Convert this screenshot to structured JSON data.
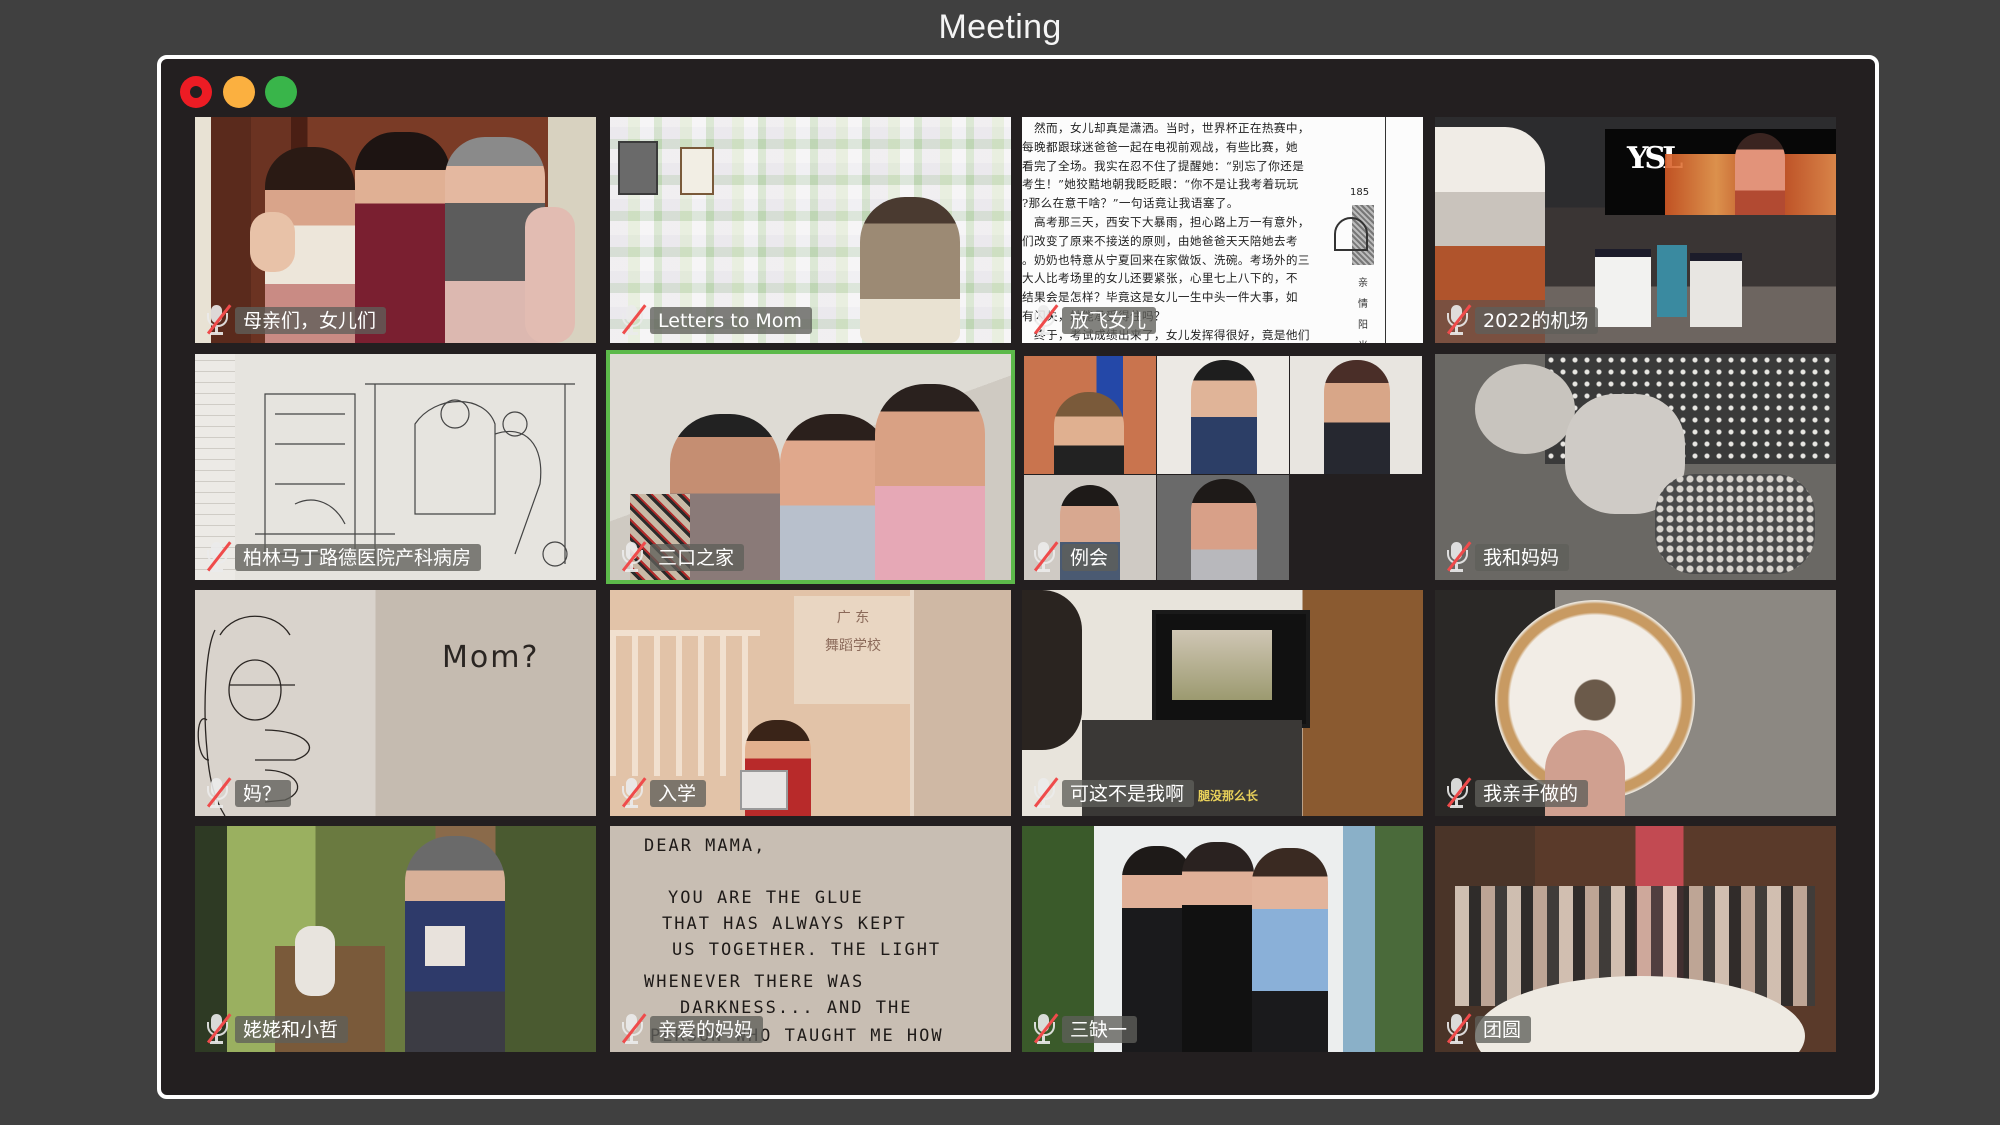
{
  "app": {
    "title": "Meeting"
  },
  "window_controls": {
    "close": "close-button",
    "minimize": "minimize-button",
    "maximize": "maximize-button"
  },
  "colors": {
    "background": "#404040",
    "window": "#231f20",
    "window_border": "#ffffff",
    "close": "#ed1c24",
    "minimize": "#fbb040",
    "maximize": "#39b54a",
    "active_speaker": "#5cb94a",
    "muted_slash": "#ef4b4b"
  },
  "participants": [
    {
      "name": "母亲们，女儿们",
      "muted": true,
      "active": false
    },
    {
      "name": "Letters to Mom",
      "muted": true,
      "active": false
    },
    {
      "name": "放飞女儿",
      "muted": true,
      "active": false
    },
    {
      "name": "2022的机场",
      "muted": true,
      "active": false
    },
    {
      "name": "柏林马丁路德医院产科病房",
      "muted": true,
      "active": false
    },
    {
      "name": "三口之家",
      "muted": true,
      "active": true
    },
    {
      "name": "例会",
      "muted": true,
      "active": false
    },
    {
      "name": "我和妈妈",
      "muted": true,
      "active": false
    },
    {
      "name": "妈？",
      "muted": true,
      "active": false
    },
    {
      "name": "入学",
      "muted": true,
      "active": false
    },
    {
      "name": "可这不是我啊",
      "muted": true,
      "active": false
    },
    {
      "name": "我亲手做的",
      "muted": true,
      "active": false
    },
    {
      "name": "姥姥和小哲",
      "muted": true,
      "active": false
    },
    {
      "name": "亲爱的妈妈",
      "muted": true,
      "active": false
    },
    {
      "name": "三缺一",
      "muted": true,
      "active": false
    },
    {
      "name": "团圆",
      "muted": true,
      "active": false
    }
  ],
  "tile_content": {
    "book_page": {
      "lines": [
        "　然而，女儿却真是潇洒。当时，世界杯正在热赛中，",
        "每晚都跟球迷爸爸一起在电视前观战，有些比赛，她",
        "看完了全场。我实在忍不住了提醒她：“别忘了你还是",
        "考生！”她狡黠地朝我眨眨眼：“你不是让我考着玩玩",
        "?那么在意干啥？”一句话竟让我语塞了。",
        "　高考那三天，西安下大暴雨，担心路上万一有意外，",
        "们改变了原来不接送的原则，由她爸爸天天陪她去考",
        "。奶奶也特意从宁夏回来在家做饭、洗碗。考场外的三",
        "大人比考场里的女儿还要紧张，心里七上八下的，不",
        "结果会是怎样？毕竟这是女儿一生中头一件大事，如",
        "有闪失，她能承受得住吗？",
        "　终于，考试成绩出来了，女儿发挥得很好，竟是他们"
      ],
      "page_number": "185",
      "side_text": "亲情阳光"
    },
    "airport_billboard": {
      "logo": "YSL"
    },
    "mom_drawing": {
      "text": "Mom?"
    },
    "school_sign": {
      "line1": "广 东",
      "line2": "舞蹈学校"
    },
    "subtitle_overlay": "腿没那么长",
    "letter": {
      "lines": [
        "DEAR MAMA,",
        "YOU ARE THE GLUE",
        "THAT HAS ALWAYS KEPT",
        "US TOGETHER. THE LIGHT",
        "WHENEVER THERE WAS",
        "DARKNESS... AND THE",
        "PERSON WHO TAUGHT ME HOW"
      ]
    }
  }
}
